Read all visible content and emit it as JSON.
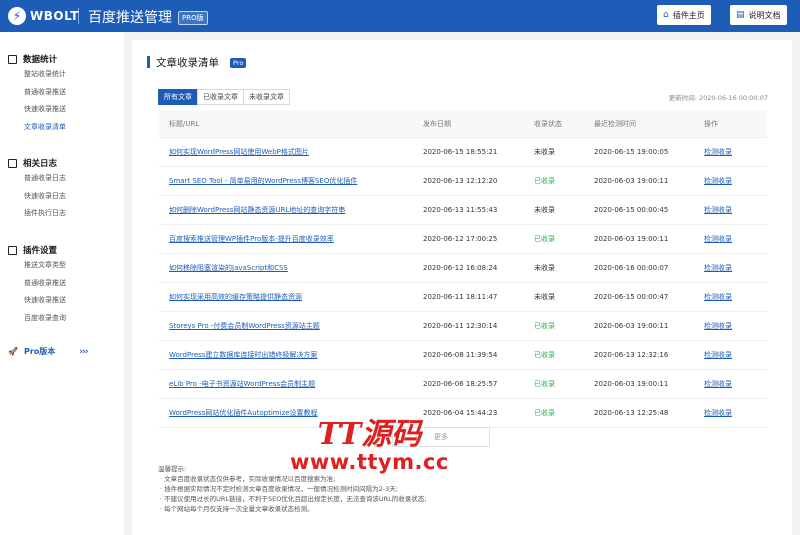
{
  "header": {
    "logo_mark": "⚡",
    "logo_text": "WBOLT",
    "app_title": "百度推送管理",
    "pro_tag": "PRO版",
    "plugin_home_label": "插件主页",
    "docs_label": "说明文档",
    "plugin_home_icon": "home-icon",
    "docs_icon": "document-icon"
  },
  "sidebar": {
    "sections": [
      {
        "title": "数据统计",
        "icon": "chart-icon",
        "items": [
          "整站收录统计",
          "普通收录推送",
          "快速收录推送",
          "文章收录清单"
        ]
      },
      {
        "title": "相关日志",
        "icon": "log-icon",
        "items": [
          "普通收录日志",
          "快速收录日志",
          "插件执行日志"
        ]
      },
      {
        "title": "插件设置",
        "icon": "settings-icon",
        "items": [
          "推送文章类型",
          "普通收录推送",
          "快速收录推送",
          "百度收录查询"
        ]
      }
    ],
    "active_item": "文章收录清单",
    "pro_label": "Pro版本",
    "pro_arrows": "›››"
  },
  "main": {
    "title": "文章收录清单",
    "pro_badge": "Pro",
    "tabs": [
      "所有文章",
      "已收录文章",
      "未收录文章"
    ],
    "active_tab": 0,
    "updated_time": "更新时间: 2020-06-16 00:00:07",
    "columns": [
      "标题/URL",
      "发布日期",
      "收录状态",
      "最近检测时间",
      "操作"
    ],
    "rows": [
      {
        "title": "如何实现WordPress网站使用WebP格式图片",
        "date": "2020-06-15 18:55:21",
        "status": "未收录",
        "indexed": false,
        "checked": "2020-06-15 19:00:05",
        "action": "检测收录"
      },
      {
        "title": "Smart SEO Tool - 简单易用的WordPress博客SEO优化插件",
        "date": "2020-06-13 12:12:20",
        "status": "已收录",
        "indexed": true,
        "checked": "2020-06-03 19:00:11",
        "action": "检测收录"
      },
      {
        "title": "如何删除WordPress网站静态资源URL地址的查询字符串",
        "date": "2020-06-13 11:55:43",
        "status": "未收录",
        "indexed": false,
        "checked": "2020-06-15 00:00:45",
        "action": "检测收录"
      },
      {
        "title": "百度搜索推送管理WP插件Pro版本-提升百度收录效率",
        "date": "2020-06-12 17:00:25",
        "status": "已收录",
        "indexed": true,
        "checked": "2020-06-03 19:00:11",
        "action": "检测收录"
      },
      {
        "title": "如何移除阻塞渲染的JavaScript和CSS",
        "date": "2020-06-12 16:08:24",
        "status": "未收录",
        "indexed": false,
        "checked": "2020-06-16 00:00:07",
        "action": "检测收录"
      },
      {
        "title": "如何实现采用高效的缓存策略提供静态资源",
        "date": "2020-06-11 18:11:47",
        "status": "未收录",
        "indexed": false,
        "checked": "2020-06-15 00:00:47",
        "action": "检测收录"
      },
      {
        "title": "Storeys Pro -付费会员制WordPress资源站主题",
        "date": "2020-06-11 12:30:14",
        "status": "已收录",
        "indexed": true,
        "checked": "2020-06-03 19:00:11",
        "action": "检测收录"
      },
      {
        "title": "WordPress建立数据库连接时出错终极解决方案",
        "date": "2020-06-08 11:39:54",
        "status": "已收录",
        "indexed": true,
        "checked": "2020-06-13 12:32:16",
        "action": "检测收录"
      },
      {
        "title": "eLib Pro -电子书资源站WordPress会员制主题",
        "date": "2020-06-06 18:25:57",
        "status": "已收录",
        "indexed": true,
        "checked": "2020-06-03 19:00:11",
        "action": "检测收录"
      },
      {
        "title": "WordPress网站优化插件Autoptimize设置教程",
        "date": "2020-06-04 15:44:23",
        "status": "已收录",
        "indexed": true,
        "checked": "2020-06-13 12:25:48",
        "action": "检测收录"
      }
    ],
    "more_label": "更多",
    "tips_title": "温馨提示:",
    "tips": [
      "文章百度收录状态仅供参考，实际收录情况以百度搜索为准;",
      "插件根据实际情况不定时检测文章百度收录情况，一般情况检测时间间隔为2-3天;",
      "不建议使用过长的URL链接，不利于SEO优化且超出规定长度，无法查询该URL的收录状态;",
      "每个网站每个月仅支持一次全量文章收录状态检测。"
    ]
  },
  "watermark": {
    "line1": "TT源码",
    "line2": "www.ttym.cc"
  },
  "colors": {
    "primary": "#1d5db8",
    "indexed": "#2bb34a",
    "watermark": "#e02020"
  }
}
